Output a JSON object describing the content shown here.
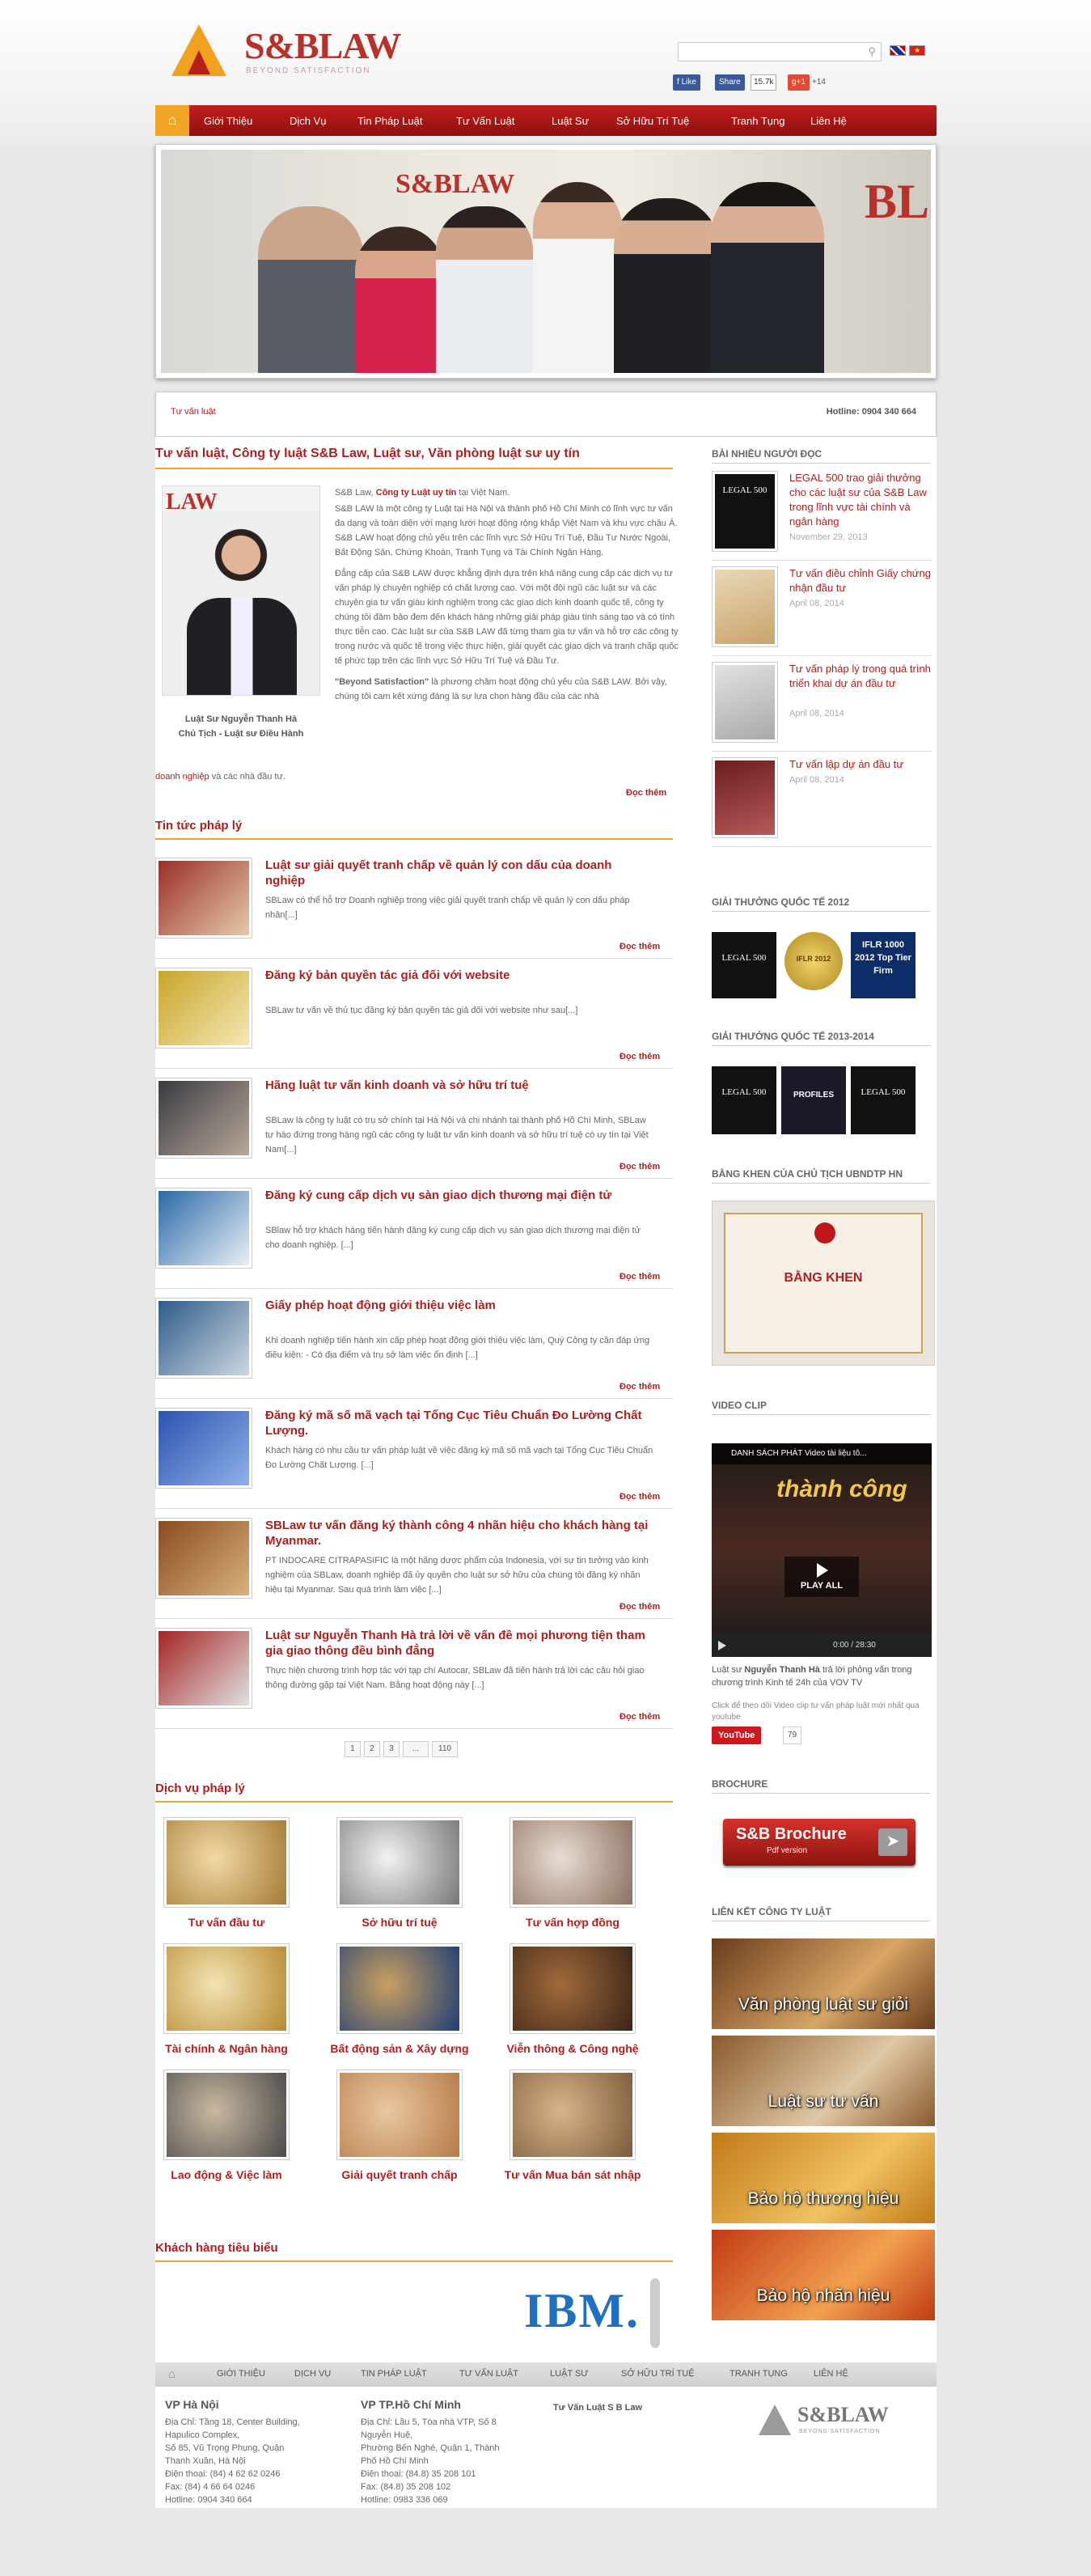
{
  "header": {
    "logo_main": "S&BLAW",
    "logo_sub": "BEYOND SATISFACTION",
    "search_placeholder": "",
    "like": "Like",
    "share": "Share",
    "share_count": "15.7k",
    "gplus": "g+1",
    "gplus_count": "+14"
  },
  "nav": {
    "items": [
      "Giới Thiệu",
      "Dịch Vụ",
      "Tin Pháp Luật",
      "Tư Vấn Luật",
      "Luật Sư",
      "Sở Hữu Trí Tuệ",
      "Tranh Tụng",
      "Liên Hệ"
    ]
  },
  "hero": {
    "sign": "S&BLAW",
    "sign2": "BL"
  },
  "breadcrumb": {
    "left": "Tư vấn luật",
    "right": "Hotline: 0904 340 664"
  },
  "intro": {
    "title": "Tư vấn luật, Công ty luật S&B Law, Luật sư, Văn phòng luật sư uy tín",
    "photo_badge": "LAW",
    "caption1": "Luật Sư Nguyễn Thanh Hà",
    "caption2": "Chủ Tịch - Luật sư Điều Hành",
    "p1_a": "S&B Law, ",
    "p1_b": "Công ty Luật uy tín",
    "p1_c": " tại Việt Nam.",
    "p2": "S&B LAW là một công ty Luật tại Hà Nội và thành phố Hồ Chí Minh có lĩnh vực tư vấn đa dạng và toàn diện với mạng lưới hoạt động rộng khắp Việt Nam và khu vực châu Á. S&B LAW hoạt động chủ yếu trên các lĩnh vực Sở Hữu Trí Tuệ, Đầu Tư Nước Ngoài, Bất Động Sản, Chứng Khoán, Tranh Tụng và Tài Chính Ngân Hàng.",
    "p3": "Đẳng cấp của S&B LAW được khẳng định dựa trên khả năng cung cấp các dịch vụ tư vấn pháp lý chuyên nghiệp có chất lượng cao. Với một đội ngũ các luật sư và các chuyên gia tư vấn giàu kinh nghiệm trong các giao dịch kinh doanh quốc tế, công ty chúng tôi đảm bảo đem đến khách hàng những giải pháp giàu tính sáng tạo và có tính thực tiễn cao. Các luật sư của S&B LAW đã từng tham gia tư vấn và hỗ trợ các công ty trong nước và quốc tế trong việc thực hiện, giải quyết các giao dịch và tranh chấp quốc tế phức tạp trên các lĩnh vực Sở Hữu Trí Tuệ và Đầu Tư.",
    "p4_a": "\"Beyond Satisfaction\"",
    "p4_b": " là phương châm hoạt động chủ yếu của S&B LAW. Bởi vậy, chúng tôi cam kết xứng đáng là sự lựa chọn hàng đầu của các nhà",
    "p5_a": "doanh nghiệp",
    "p5_b": " và các nhà đầu tư.",
    "more": "Đọc thêm"
  },
  "news": {
    "heading": "Tin tức pháp lý",
    "more": "Đọc thêm",
    "items": [
      {
        "title": "Luật sư giải quyết tranh chấp về quản lý con dấu của doanh nghiệp",
        "desc": "SBLaw có thể hỗ trợ Doanh nghiệp trong việc giải quyết tranh chấp về quản lý con dấu pháp nhân[...]",
        "c1": "#9a2f2a",
        "c2": "#e5c9a8"
      },
      {
        "title": "Đăng ký bản quyền tác giả đối với website",
        "desc": "SBLaw tư vấn về thủ tục đăng ký bản quyền tác giả đối với website như sau[...]",
        "c1": "#c9a52a",
        "c2": "#f4e7b5"
      },
      {
        "title": "Hãng luật tư vấn kinh doanh và sở hữu trí tuệ",
        "desc": "SBLaw là công ty luật có trụ sở chính tại Hà Nội và chi nhánh tại thành phố Hồ Chí Minh, SBLaw tự hào đứng trong hàng ngũ các công ty luật tư vấn kinh doanh và sở hữu trí tuệ có uy tín tại Việt Nam[...]",
        "c1": "#3a3a42",
        "c2": "#b7a898"
      },
      {
        "title": "Đăng ký cung cấp dịch vụ sàn giao dịch thương mại điện tử",
        "desc": "SBlaw hỗ trợ khách hàng tiến hành đăng ký cung cấp dịch vụ sàn giao dịch thương mại điện tử cho doanh nghiệp. [...]",
        "c1": "#2a6aa8",
        "c2": "#e9eef4"
      },
      {
        "title": "Giấy phép hoạt động giới thiệu việc làm",
        "desc": "Khi doanh nghiệp tiến hành xin cấp phép hoạt động giới thiệu việc làm, Quý Công ty cần đáp ứng điều kiện: - Có địa điểm và trụ sở làm việc ổn định [...]",
        "c1": "#2d5c8a",
        "c2": "#cdd7e0"
      },
      {
        "title": "Đăng ký mã số mã vạch tại Tổng Cục Tiêu Chuẩn Đo Lường Chất Lượng.",
        "desc": "Khách hàng có nhu cầu tư vấn pháp luật về việc đăng ký mã số mã vạch tại Tổng Cục Tiêu Chuẩn Đo Lường Chất Lượng. [...]",
        "c1": "#2c53b0",
        "c2": "#8fb0e8"
      },
      {
        "title": "SBLaw tư vấn đăng ký thành công 4 nhãn hiệu cho khách hàng tại Myanmar.",
        "desc": "PT INDOCARE CITRAPASIFIC là một hãng dược phẩm của Indonesia, với sự tin tưởng vào kinh nghiệm của SBLaw, doanh nghiệp đã ủy quyền cho luật sư sở hữu của chúng tôi đăng ký nhãn hiệu tại Myanmar. Sau quá trình làm việc [...]",
        "c1": "#8a4a20",
        "c2": "#d8b27c"
      },
      {
        "title": "Luật sư Nguyễn Thanh Hà trả lời về vấn đề mọi phương tiện tham gia giao thông đều bình đẳng",
        "desc": "Thực hiện chương trình hợp tác với tạp chí Autocar, SBLaw đã tiến hành trả lời các câu hỏi giao thông đường gặp tại Việt Nam. Bằng hoạt động này [...]",
        "c1": "#a52424",
        "c2": "#e0e0e0"
      }
    ]
  },
  "pagination": [
    "1",
    "2",
    "3",
    "...",
    "110"
  ],
  "services": {
    "heading": "Dịch vụ pháp lý",
    "items": [
      {
        "label": "Tư vấn đầu tư",
        "c1": "#a57a35",
        "c2": "#f1d9a5"
      },
      {
        "label": "Sở hữu trí tuệ",
        "c1": "#777777",
        "c2": "#f2f2f2"
      },
      {
        "label": "Tư vấn hợp đồng",
        "c1": "#8a7060",
        "c2": "#e8ddd2"
      },
      {
        "label": "Tài chính & Ngân hàng",
        "c1": "#b88a2e",
        "c2": "#f2e3b5"
      },
      {
        "label": "Bất động sản & Xây dựng",
        "c1": "#1f3e75",
        "c2": "#c8a060"
      },
      {
        "label": "Viễn thông & Công nghệ",
        "c1": "#3a2418",
        "c2": "#a06a3a"
      },
      {
        "label": "Lao động & Việc làm",
        "c1": "#4a4a4a",
        "c2": "#c8b8a0"
      },
      {
        "label": "Giải quyết tranh chấp",
        "c1": "#b67a48",
        "c2": "#e8c8a0"
      },
      {
        "label": "Tư vấn Mua bán sát nhập",
        "c1": "#7a5a3a",
        "c2": "#d9b48a"
      }
    ]
  },
  "clients": {
    "heading": "Khách hàng tiêu biểu",
    "logo": "IBM."
  },
  "sidebar": {
    "popular_heading": "BÀI NHIỀU NGƯỜI ĐỌC",
    "popular": [
      {
        "title": "LEGAL 500 trao giải thưởng cho các luật sư của S&B Law trong lĩnh vực tài chính và ngân hàng",
        "date": "November 29, 2013",
        "thumb": "LEGAL 500"
      },
      {
        "title": "Tư vấn điều chỉnh Giấy chứng nhận đầu tư",
        "date": "April 08, 2014",
        "thumb": ""
      },
      {
        "title": "Tư vấn pháp lý trong quá trình triển khai dự án đầu tư",
        "date": "April 08, 2014",
        "thumb": ""
      },
      {
        "title": "Tư vấn lập dự án đầu tư",
        "date": "April 08, 2014",
        "thumb": ""
      }
    ],
    "award2012_heading": "GIẢI THƯỞNG QUỐC TẾ 2012",
    "award2012": [
      "LEGAL 500",
      "IFLR 2012",
      "IFLR 1000 2012 Top Tier Firm"
    ],
    "award2014_heading": "GIẢI THƯỞNG QUỐC TẾ 2013-2014",
    "award2014": [
      "LEGAL 500",
      "PROFILES",
      "LEGAL 500"
    ],
    "merit_heading": "BẰNG KHEN CỦA CHỦ TỊCH UBNDTP HN",
    "merit_text": "BẰNG KHEN",
    "video_heading": "VIDEO CLIP",
    "video_top": "DANH SÁCH PHÁT   Video tài liệu tô...",
    "video_overlay": "thành công",
    "video_play": "PLAY ALL",
    "video_time": "0:00 / 28:30",
    "video_caption_a": "Luật sư ",
    "video_caption_b": "Nguyễn Thanh Hà",
    "video_caption_c": " trả lời phỏng vấn trong chương trình Kinh tế 24h của VOV TV",
    "video_note": "Click để theo dõi Video clip tư vấn pháp luật mới nhất qua youtube",
    "youtube": "YouTube",
    "youtube_count": "79",
    "brochure_heading": "BROCHURE",
    "brochure_title": "S&B Brochure",
    "brochure_sub": "Pdf version",
    "links_heading": "LIÊN KẾT CÔNG TY LUẬT",
    "links": [
      {
        "label": "Văn phòng luật sư giỏi",
        "c1": "#6b3c1c",
        "c2": "#d7a565"
      },
      {
        "label": "Luật sư tư vấn",
        "c1": "#8a5a2c",
        "c2": "#e0c8a5"
      },
      {
        "label": "Bảo hộ thương hiệu",
        "c1": "#c27a18",
        "c2": "#f2c260"
      },
      {
        "label": "Bảo hộ nhãn hiệu",
        "c1": "#c23a14",
        "c2": "#f2a050"
      }
    ]
  },
  "footer": {
    "nav": [
      "GIỚI THIỆU",
      "DỊCH VỤ",
      "TIN PHÁP LUẬT",
      "TƯ VẤN LUẬT",
      "LUẬT SƯ",
      "SỞ HỮU TRÍ TUỆ",
      "TRANH TỤNG",
      "LIÊN HỆ"
    ],
    "hn_title": "VP Hà Nội",
    "hn_lines": [
      "Địa Chỉ: Tầng 18, Center Building,",
      "Hapulico Complex,",
      "Số 85, Vũ Trọng Phụng, Quận",
      "Thanh Xuân, Hà Nội",
      "Điện thoại: (84) 4 62 62 0246",
      "Fax: (84) 4 66 64 0246",
      "Hotline: 0904 340 664"
    ],
    "hcm_title": "VP TP.Hồ Chí Minh",
    "hcm_lines": [
      "Địa Chỉ: Lầu 5, Tòa nhà VTP, Số 8",
      "Nguyễn Huệ,",
      "Phường Bến Nghé, Quận 1, Thành",
      "Phố Hồ Chí Minh",
      "Điện thoại: (84.8) 35 208 101",
      "Fax: (84.8) 35 208 102",
      "Hotline: 0983 336 069"
    ],
    "tagline": "Tư Vấn Luật S B Law",
    "logo": "S&BLAW",
    "logo_sub": "BEYOND SATISFACTION"
  }
}
